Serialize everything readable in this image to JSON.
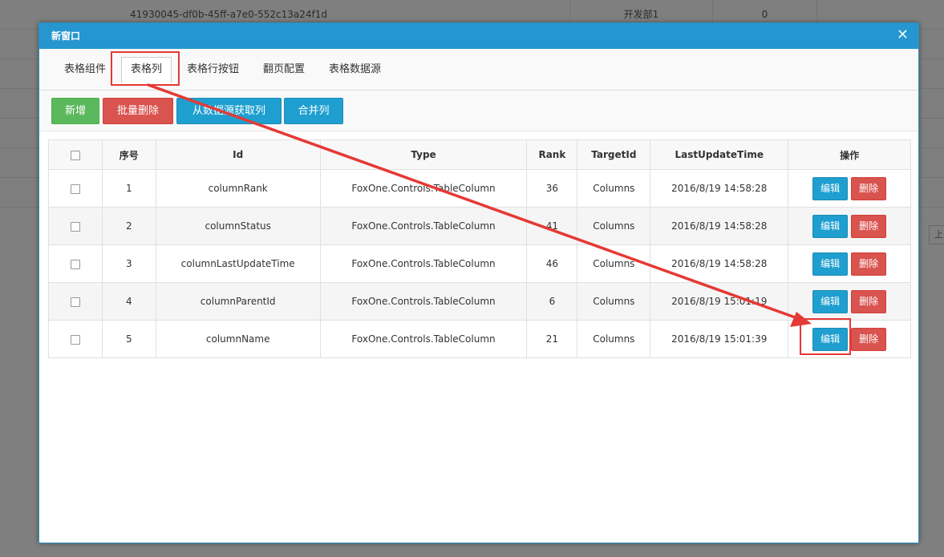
{
  "background": {
    "row0": {
      "hash": "41930045-df0b-45ff-a7e0-552c13a24f1d",
      "dept": "开发部1",
      "num": "0"
    },
    "pager": "上"
  },
  "modal": {
    "title": "新窗口",
    "close_icon": "close-icon"
  },
  "tabs": [
    {
      "label": "表格组件"
    },
    {
      "label": "表格列"
    },
    {
      "label": "表格行按钮"
    },
    {
      "label": "翻页配置"
    },
    {
      "label": "表格数据源"
    }
  ],
  "toolbar": {
    "add_label": "新增",
    "batch_delete_label": "批量删除",
    "fetch_columns_label": "从数据源获取列",
    "merge_columns_label": "合并列"
  },
  "table": {
    "headers": [
      "序号",
      "Id",
      "Type",
      "Rank",
      "TargetId",
      "LastUpdateTime",
      "操作"
    ],
    "rows": [
      {
        "no": "1",
        "id": "columnRank",
        "type": "FoxOne.Controls.TableColumn",
        "rank": "36",
        "target": "Columns",
        "time": "2016/8/19 14:58:28"
      },
      {
        "no": "2",
        "id": "columnStatus",
        "type": "FoxOne.Controls.TableColumn",
        "rank": "41",
        "target": "Columns",
        "time": "2016/8/19 14:58:28"
      },
      {
        "no": "3",
        "id": "columnLastUpdateTime",
        "type": "FoxOne.Controls.TableColumn",
        "rank": "46",
        "target": "Columns",
        "time": "2016/8/19 14:58:28"
      },
      {
        "no": "4",
        "id": "columnParentId",
        "type": "FoxOne.Controls.TableColumn",
        "rank": "6",
        "target": "Columns",
        "time": "2016/8/19 15:01:19"
      },
      {
        "no": "5",
        "id": "columnName",
        "type": "FoxOne.Controls.TableColumn",
        "rank": "21",
        "target": "Columns",
        "time": "2016/8/19 15:01:39"
      }
    ],
    "edit_label": "编辑",
    "delete_label": "删除"
  },
  "colors": {
    "header_blue": "#2596cf",
    "annotation_red": "#e53935",
    "btn_green": "#5cb85c",
    "btn_red": "#d9534f",
    "btn_blue": "#1f9fcf"
  }
}
